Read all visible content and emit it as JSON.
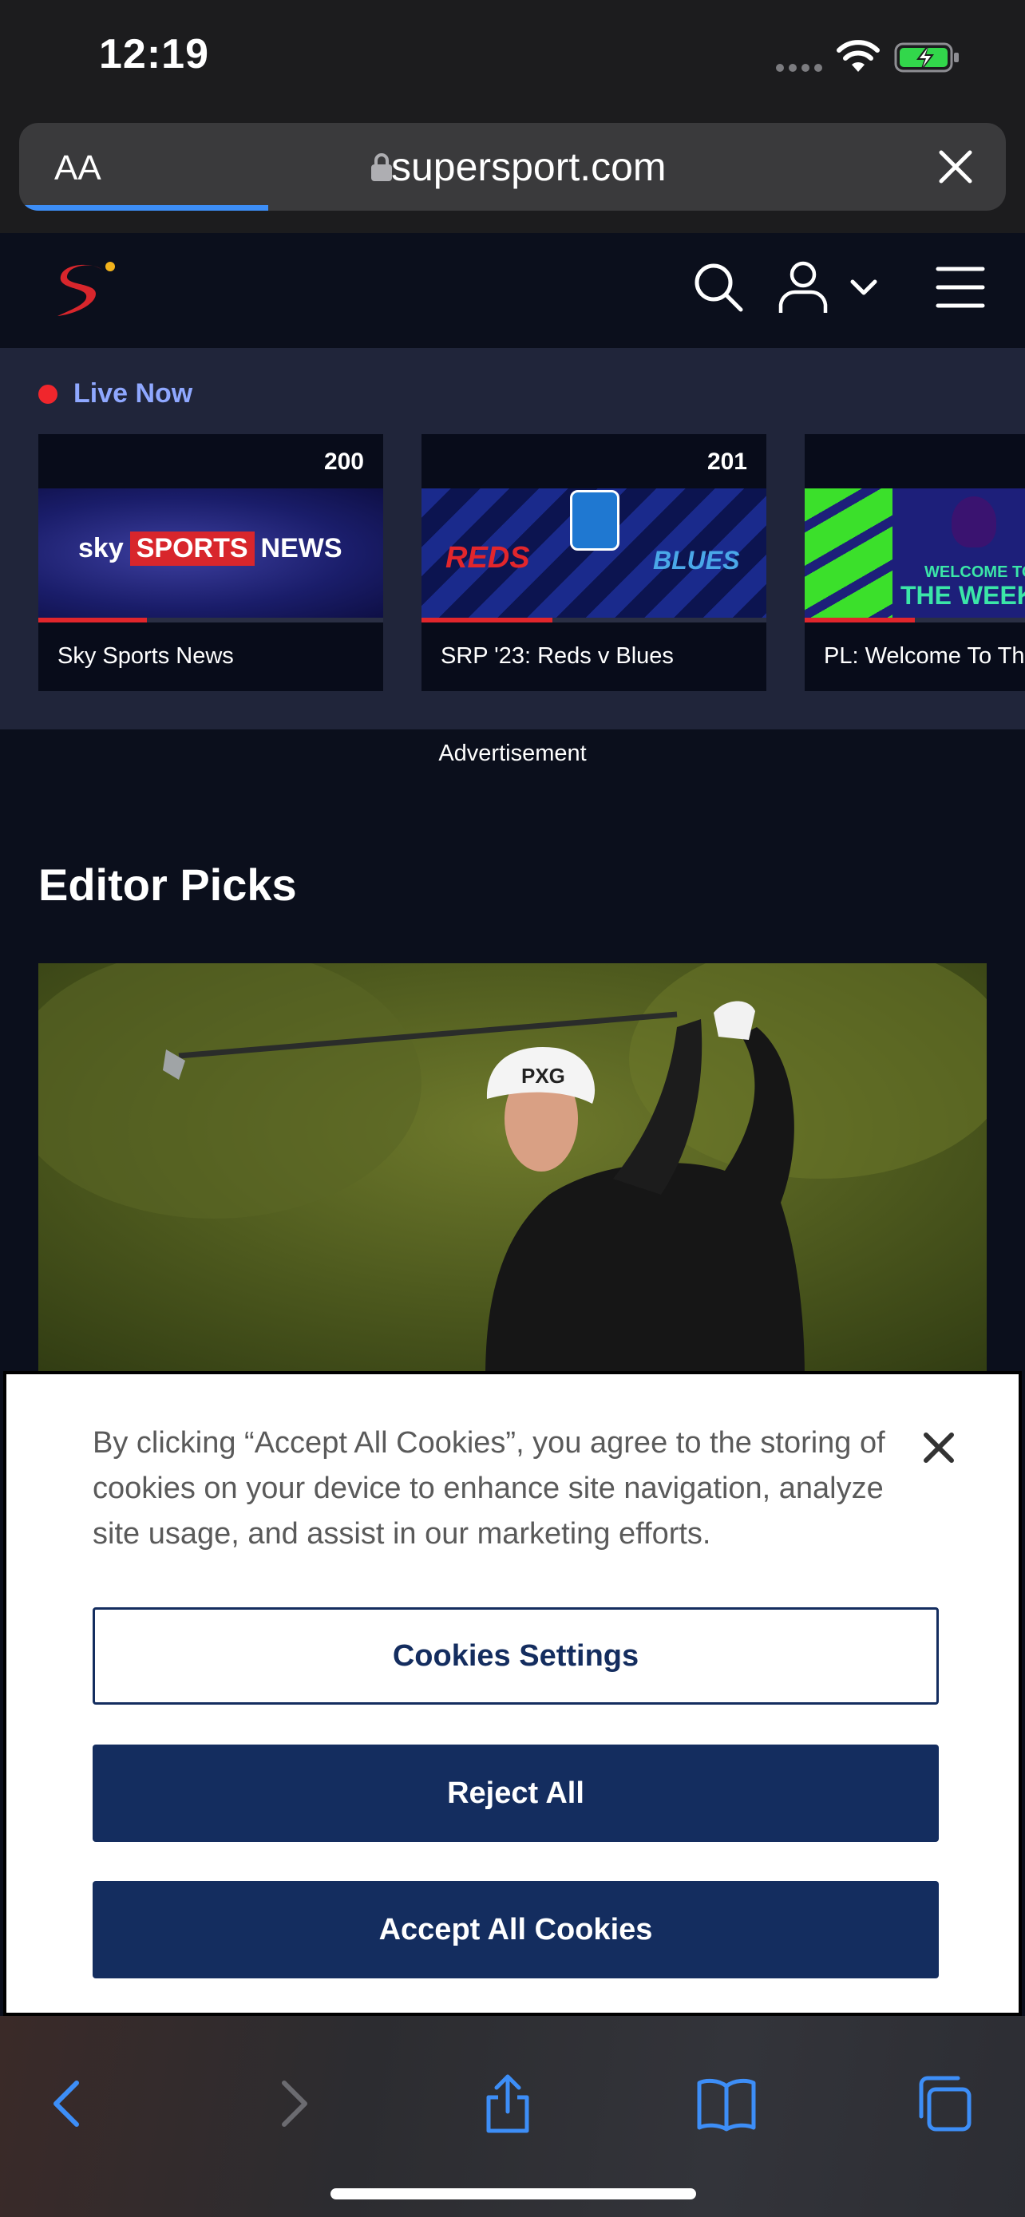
{
  "status_bar": {
    "time": "12:19"
  },
  "browser": {
    "text_size_label": "AA",
    "url": "supersport.com"
  },
  "live_now": {
    "label": "Live Now",
    "cards": [
      {
        "channel": "200",
        "title": "Sky Sports News",
        "thumb_text": [
          "sky",
          "SPORTS",
          "NEWS"
        ]
      },
      {
        "channel": "201",
        "title": "SRP '23: Reds v Blues",
        "thumb_text": [
          "REDS",
          "BLUES"
        ]
      },
      {
        "channel": "",
        "title": "PL: Welcome To Th",
        "thumb_text": [
          "WELCOME TO",
          "THE WEEKEN"
        ]
      }
    ]
  },
  "advertisement_label": "Advertisement",
  "editor_picks": {
    "title": "Editor Picks"
  },
  "cookie_banner": {
    "message": "By clicking “Accept All Cookies”, you agree to the storing of cookies on your device to enhance site navigation, analyze site usage, and assist in our marketing efforts.",
    "settings_label": "Cookies Settings",
    "reject_label": "Reject All",
    "accept_label": "Accept All Cookies"
  },
  "colors": {
    "live_dot": "#f0262c",
    "live_label": "#8fa8ff",
    "cookie_button": "#142d5f",
    "safari_accent": "#3d8ef7"
  }
}
